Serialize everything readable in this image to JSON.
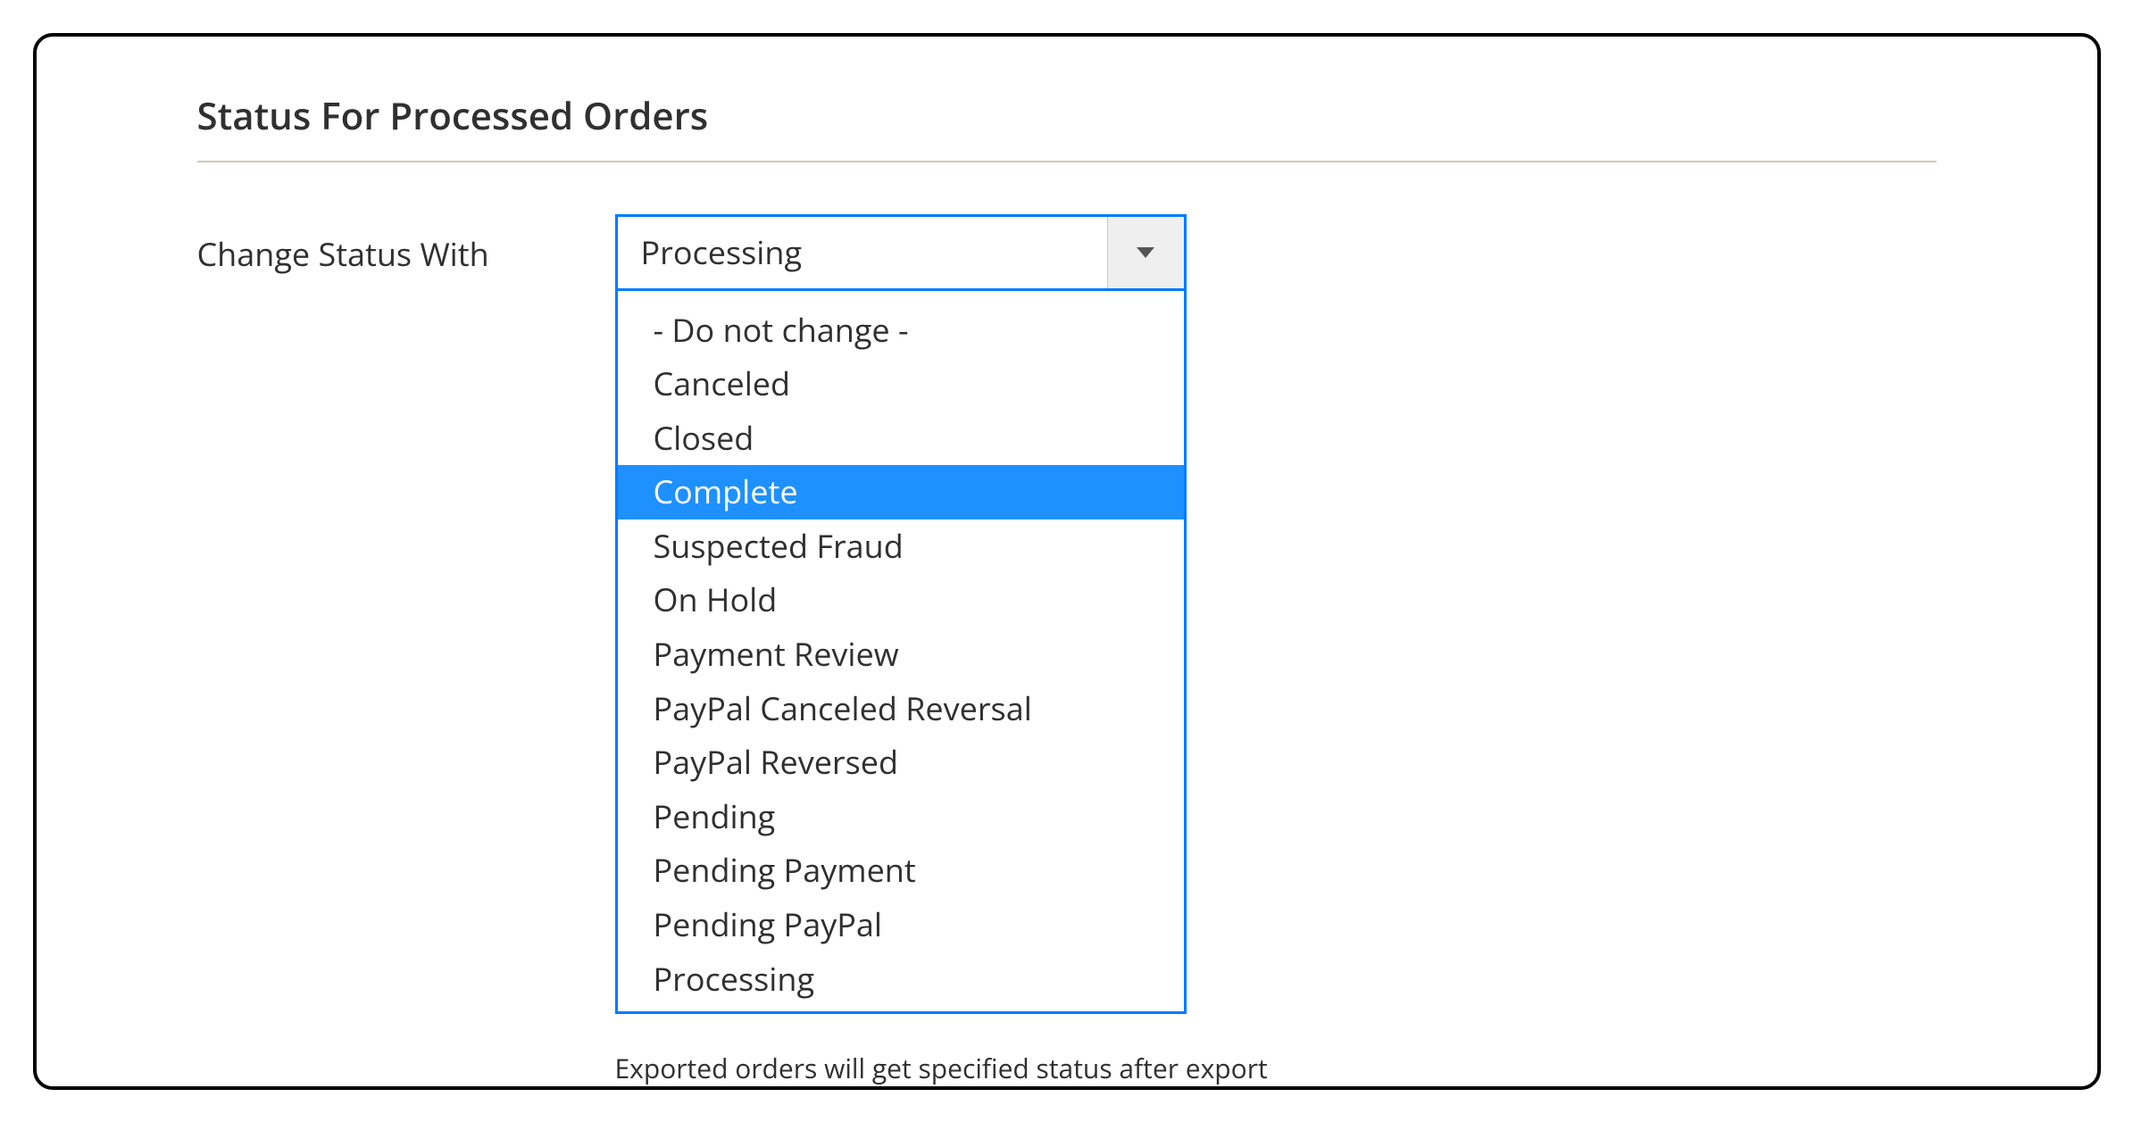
{
  "section": {
    "title": "Status For Processed Orders"
  },
  "field": {
    "label": "Change Status With",
    "selected": "Processing",
    "highlighted_index": 3,
    "options": [
      "- Do not change -",
      "Canceled",
      "Closed",
      "Complete",
      "Suspected Fraud",
      "On Hold",
      "Payment Review",
      "PayPal Canceled Reversal",
      "PayPal Reversed",
      "Pending",
      "Pending Payment",
      "Pending PayPal",
      "Processing"
    ],
    "help": "Exported orders will get specified status after export"
  }
}
